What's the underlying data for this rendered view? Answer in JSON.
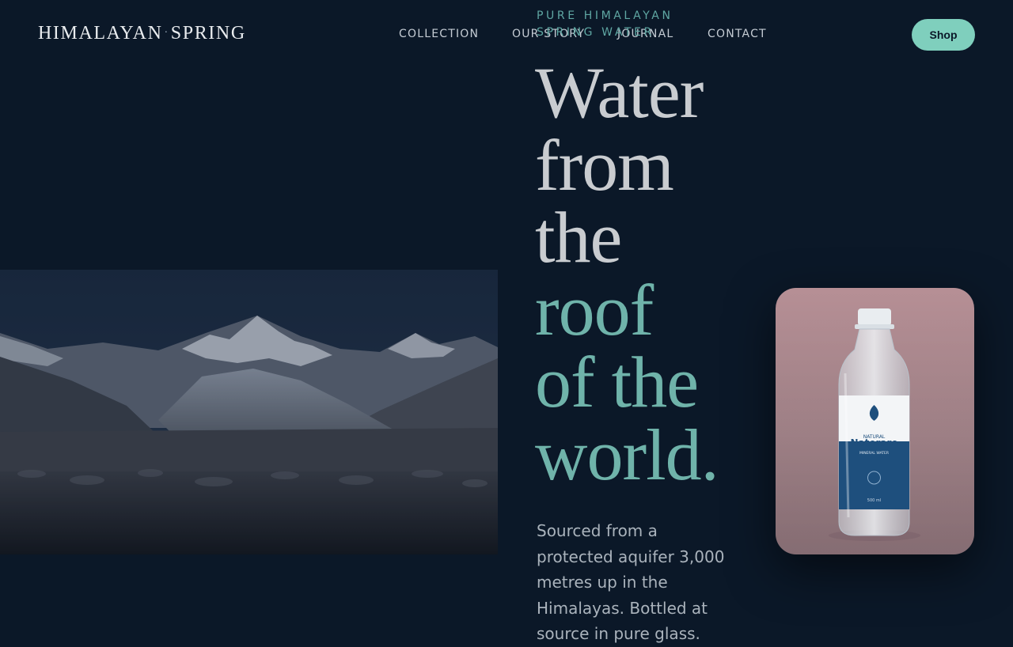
{
  "brand": {
    "left": "HIMALAYAN",
    "dot": "·",
    "right": "SPRING"
  },
  "nav": {
    "items": [
      {
        "label": "COLLECTION"
      },
      {
        "label": "OUR STORY"
      },
      {
        "label": "JOURNAL"
      },
      {
        "label": "CONTACT"
      }
    ],
    "shop_label": "Shop"
  },
  "hero": {
    "eyebrow": "PURE HIMALAYAN SPRING WATER",
    "headline_plain": [
      "Water",
      "from",
      "the"
    ],
    "headline_accent": [
      "roof",
      "of the",
      "world."
    ],
    "lead": "Sourced from a protected aquifer 3,000 metres up in the Himalayas. Bottled at source in pure glass."
  },
  "bottle": {
    "label_top": "NATURAL",
    "label_brand": "Naterare",
    "label_sub": "MINERAL WATER",
    "label_volume": "500 ml"
  },
  "colors": {
    "background": "#0b1828",
    "accent": "#6fb3aa",
    "button": "#7fcfbd",
    "card": "#b68f95",
    "label_blue": "#1e4f7d"
  }
}
